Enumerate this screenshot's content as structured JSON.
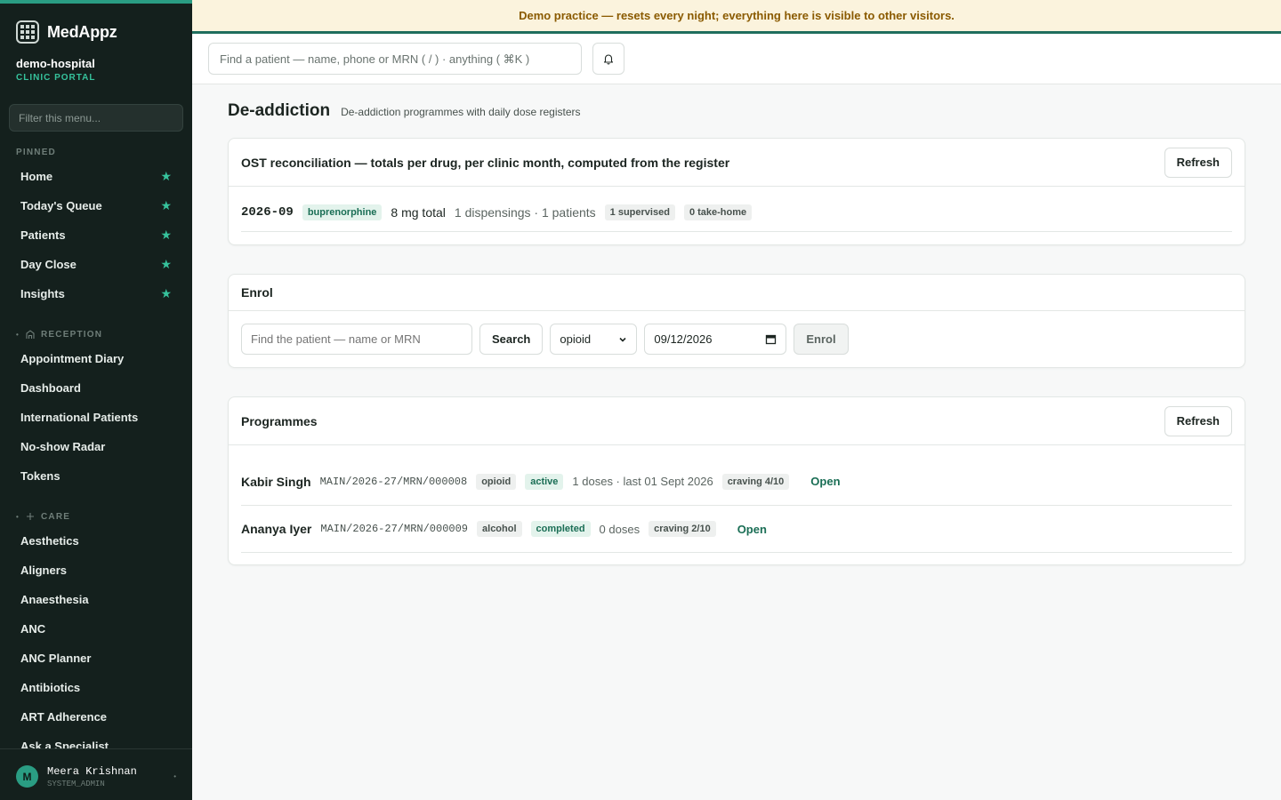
{
  "app": {
    "brand": "MedAppz",
    "org_name": "demo-hospital",
    "org_sub": "CLINIC PORTAL"
  },
  "banner": "Demo practice — resets every night; everything here is visible to other visitors.",
  "sidebar": {
    "filter_placeholder": "Filter this menu...",
    "pinned_label": "PINNED",
    "pinned": [
      {
        "label": "Home"
      },
      {
        "label": "Today's Queue"
      },
      {
        "label": "Patients"
      },
      {
        "label": "Day Close"
      },
      {
        "label": "Insights"
      }
    ],
    "reception_label": "RECEPTION",
    "reception": [
      {
        "label": "Appointment Diary"
      },
      {
        "label": "Dashboard"
      },
      {
        "label": "International Patients"
      },
      {
        "label": "No-show Radar"
      },
      {
        "label": "Tokens"
      }
    ],
    "care_label": "CARE",
    "care": [
      {
        "label": "Aesthetics"
      },
      {
        "label": "Aligners"
      },
      {
        "label": "Anaesthesia"
      },
      {
        "label": "ANC"
      },
      {
        "label": "ANC Planner"
      },
      {
        "label": "Antibiotics"
      },
      {
        "label": "ART Adherence"
      },
      {
        "label": "Ask a Specialist"
      }
    ],
    "user": {
      "initial": "M",
      "name": "Meera Krishnan",
      "role": "SYSTEM_ADMIN"
    }
  },
  "topbar": {
    "search_placeholder": "Find a patient — name, phone or MRN ( / ) · anything ( ⌘K )"
  },
  "page": {
    "title": "De-addiction",
    "subtitle": "De-addiction programmes with daily dose registers"
  },
  "ost": {
    "title": "OST reconciliation — totals per drug, per clinic month, computed from the register",
    "refresh_label": "Refresh",
    "row": {
      "month": "2026-09",
      "drug": "buprenorphine",
      "total": "8 mg total",
      "summary": "1 dispensings · 1 patients",
      "supervised": "1 supervised",
      "take_home": "0 take-home"
    }
  },
  "enrol": {
    "title": "Enrol",
    "patient_placeholder": "Find the patient — name or MRN",
    "search_label": "Search",
    "type_value": "opioid",
    "date_value": "09/12/2026",
    "enrol_label": "Enrol"
  },
  "programmes": {
    "title": "Programmes",
    "refresh_label": "Refresh",
    "rows": [
      {
        "name": "Kabir Singh",
        "mrn": "MAIN/2026-27/MRN/000008",
        "type": "opioid",
        "status": "active",
        "doses": "1 doses · last 01 Sept 2026",
        "craving": "craving 4/10",
        "action": "Open"
      },
      {
        "name": "Ananya Iyer",
        "mrn": "MAIN/2026-27/MRN/000009",
        "type": "alcohol",
        "status": "completed",
        "doses": "0 doses",
        "craving": "craving 2/10",
        "action": "Open"
      }
    ]
  },
  "colors": {
    "sidebar_bg": "#14201d",
    "accent": "#2a9d83",
    "banner_bg": "#fbf3dd",
    "banner_text": "#8a5a00",
    "link": "#1a6e55"
  }
}
